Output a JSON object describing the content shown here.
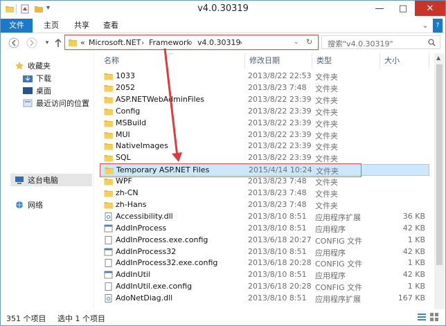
{
  "window": {
    "title": "v4.0.30319",
    "min": "—",
    "max": "□",
    "close": "✕"
  },
  "ribbon": {
    "tabs": [
      "文件",
      "主页",
      "共享",
      "查看"
    ]
  },
  "address": {
    "prefix": "«",
    "parts": [
      "Microsoft.NET",
      "Framework",
      "v4.0.30319"
    ],
    "sep": "›"
  },
  "search": {
    "placeholder": "搜索\"v4.0.30319\""
  },
  "sidebar": {
    "items": [
      {
        "label": "收藏夹",
        "icon": "star-icon"
      },
      {
        "label": "下载",
        "icon": "download-icon"
      },
      {
        "label": "桌面",
        "icon": "desktop-icon"
      },
      {
        "label": "最近访问的位置",
        "icon": "recent-icon"
      },
      {
        "label": "这台电脑",
        "icon": "computer-icon"
      },
      {
        "label": "网络",
        "icon": "network-icon"
      }
    ]
  },
  "columns": {
    "name": "名称",
    "date": "修改日期",
    "type": "类型",
    "size": "大小"
  },
  "files": [
    {
      "name": "1033",
      "date": "2013/8/22 22:53",
      "type": "文件夹",
      "size": "",
      "kind": "folder"
    },
    {
      "name": "2052",
      "date": "2013/8/23 7:48",
      "type": "文件夹",
      "size": "",
      "kind": "folder"
    },
    {
      "name": "ASP.NETWebAdminFiles",
      "date": "2013/8/22 23:39",
      "type": "文件夹",
      "size": "",
      "kind": "folder"
    },
    {
      "name": "Config",
      "date": "2013/8/22 23:39",
      "type": "文件夹",
      "size": "",
      "kind": "folder"
    },
    {
      "name": "MSBuild",
      "date": "2013/8/22 23:39",
      "type": "文件夹",
      "size": "",
      "kind": "folder"
    },
    {
      "name": "MUI",
      "date": "2013/8/22 23:39",
      "type": "文件夹",
      "size": "",
      "kind": "folder"
    },
    {
      "name": "NativeImages",
      "date": "2013/8/22 23:39",
      "type": "文件夹",
      "size": "",
      "kind": "folder"
    },
    {
      "name": "SQL",
      "date": "2013/8/22 23:39",
      "type": "文件夹",
      "size": "",
      "kind": "folder"
    },
    {
      "name": "Temporary ASP.NET Files",
      "date": "2015/4/14 10:24",
      "type": "文件夹",
      "size": "",
      "kind": "folder",
      "selected": true
    },
    {
      "name": "WPF",
      "date": "2013/8/23 7:48",
      "type": "文件夹",
      "size": "",
      "kind": "folder"
    },
    {
      "name": "zh-CN",
      "date": "2013/8/23 7:48",
      "type": "文件夹",
      "size": "",
      "kind": "folder"
    },
    {
      "name": "zh-Hans",
      "date": "2013/8/23 7:48",
      "type": "文件夹",
      "size": "",
      "kind": "folder"
    },
    {
      "name": "Accessibility.dll",
      "date": "2013/8/10 8:51",
      "type": "应用程序扩展",
      "size": "36 KB",
      "kind": "dll"
    },
    {
      "name": "AddInProcess",
      "date": "2013/8/10 8:51",
      "type": "应用程序",
      "size": "42 KB",
      "kind": "exe"
    },
    {
      "name": "AddInProcess.exe.config",
      "date": "2013/6/18 20:27",
      "type": "CONFIG 文件",
      "size": "1 KB",
      "kind": "config"
    },
    {
      "name": "AddInProcess32",
      "date": "2013/8/10 8:51",
      "type": "应用程序",
      "size": "42 KB",
      "kind": "exe"
    },
    {
      "name": "AddInProcess32.exe.config",
      "date": "2013/6/18 20:28",
      "type": "CONFIG 文件",
      "size": "1 KB",
      "kind": "config"
    },
    {
      "name": "AddInUtil",
      "date": "2013/8/10 8:51",
      "type": "应用程序",
      "size": "42 KB",
      "kind": "exe"
    },
    {
      "name": "AddInUtil.exe.config",
      "date": "2013/6/18 20:28",
      "type": "CONFIG 文件",
      "size": "1 KB",
      "kind": "config"
    },
    {
      "name": "AdoNetDiag.dll",
      "date": "2013/8/10 8:51",
      "type": "应用程序扩展",
      "size": "167 KB",
      "kind": "dll"
    }
  ],
  "status": {
    "count": "351 个项目",
    "selected": "选中 1 个项目"
  },
  "colors": {
    "accent": "#1979ca",
    "selection": "#cce8ff",
    "highlight": "#e05a5a",
    "folder": "#e8b93c"
  }
}
